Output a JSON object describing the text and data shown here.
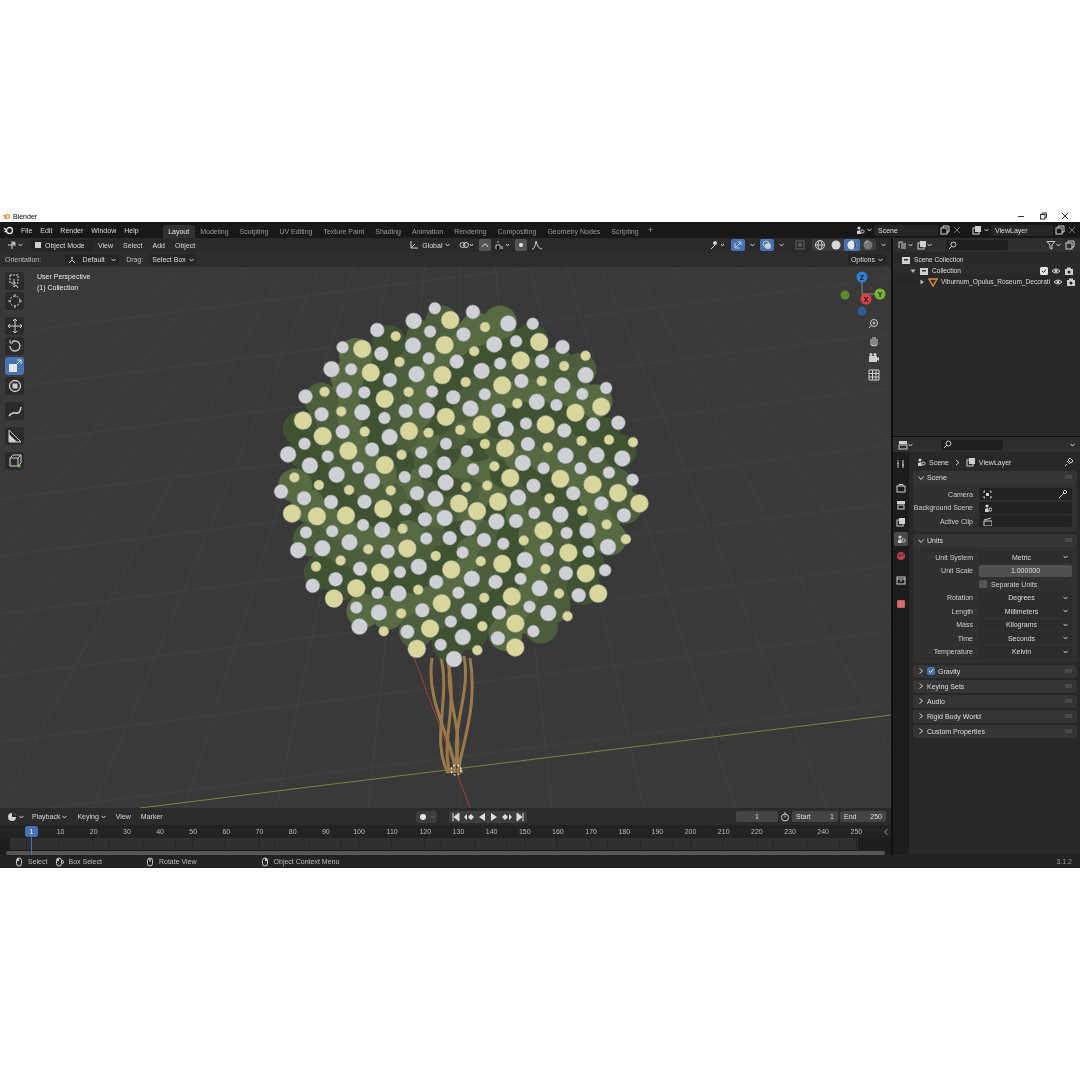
{
  "window": {
    "title": "Blender"
  },
  "menu": [
    "File",
    "Edit",
    "Render",
    "Window",
    "Help"
  ],
  "workspaces": [
    {
      "label": "Layout",
      "selected": true
    },
    {
      "label": "Modeling",
      "selected": false
    },
    {
      "label": "Sculpting",
      "selected": false
    },
    {
      "label": "UV Editing",
      "selected": false
    },
    {
      "label": "Texture Paint",
      "selected": false
    },
    {
      "label": "Shading",
      "selected": false
    },
    {
      "label": "Animation",
      "selected": false
    },
    {
      "label": "Rendering",
      "selected": false
    },
    {
      "label": "Compositing",
      "selected": false
    },
    {
      "label": "Geometry Nodes",
      "selected": false
    },
    {
      "label": "Scripting",
      "selected": false
    }
  ],
  "add_workspace": "+",
  "scene": "Scene",
  "view_layer": "ViewLayer",
  "viewport": {
    "mode": "Object Mode",
    "menus": [
      "View",
      "Select",
      "Add",
      "Object"
    ],
    "transform_orientation": "Global",
    "orientation_label": "Orientation:",
    "orientation": "Default",
    "drag_label": "Drag:",
    "drag": "Select Box",
    "options": "Options",
    "view_name": "User Perspective",
    "collection_label": "(1) Collection",
    "show_gizmos": true,
    "show_overlays": true,
    "xray": false,
    "shading": [
      {
        "kind": "wireframe",
        "selected": false
      },
      {
        "kind": "solid",
        "selected": false
      },
      {
        "kind": "material",
        "selected": true
      },
      {
        "kind": "rendered",
        "selected": false
      }
    ],
    "tools": [
      {
        "kind": "select_box",
        "selected": false
      },
      {
        "kind": "cursor",
        "selected": false
      },
      {
        "kind": "move",
        "selected": false
      },
      {
        "kind": "rotate",
        "selected": false
      },
      {
        "kind": "scale",
        "selected": true
      },
      {
        "kind": "transform",
        "selected": false
      },
      {
        "kind": "annotate",
        "selected": false
      },
      {
        "kind": "measure",
        "selected": false
      },
      {
        "kind": "add_cube",
        "selected": false
      }
    ],
    "gizmo_axes": [
      "Z",
      "Y",
      "X"
    ]
  },
  "outliner": {
    "tree": [
      {
        "label": "Scene Collection",
        "children": [
          {
            "label": "Collection",
            "expanded": true,
            "checked": true,
            "children": [
              {
                "label": "Viburnum_Opulus_Roseum_Decorati",
                "expanded": false
              }
            ]
          }
        ]
      }
    ]
  },
  "properties": {
    "tabs": [
      {
        "kind": "tool",
        "selected": false
      },
      {
        "kind": "render",
        "selected": false
      },
      {
        "kind": "output",
        "selected": false
      },
      {
        "kind": "view_layer",
        "selected": false
      },
      {
        "kind": "scene",
        "selected": true
      },
      {
        "kind": "world",
        "selected": false
      },
      {
        "kind": "collection",
        "selected": false
      },
      {
        "kind": "texture",
        "selected": false
      }
    ],
    "breadcrumb": [
      "Scene",
      "ViewLayer"
    ],
    "panels": [
      {
        "title": "Scene",
        "expanded": true,
        "rows": [
          {
            "label": "Camera",
            "kind": "camera"
          },
          {
            "label": "Background Scene",
            "kind": "scene"
          },
          {
            "label": "Active Clip",
            "kind": "clip"
          }
        ]
      },
      {
        "title": "Units",
        "expanded": true,
        "rows": [
          {
            "label": "Unit System",
            "kind": "dropdown",
            "value": "Metric"
          },
          {
            "label": "Unit Scale",
            "kind": "number",
            "value": "1.000000"
          },
          {
            "label": "Separate Units",
            "kind": "checkbox",
            "checked": false
          },
          {
            "label": "Rotation",
            "kind": "dropdown",
            "value": "Degrees"
          },
          {
            "label": "Length",
            "kind": "dropdown",
            "value": "Millimeters"
          },
          {
            "label": "Mass",
            "kind": "dropdown",
            "value": "Kilograms"
          },
          {
            "label": "Time",
            "kind": "dropdown",
            "value": "Seconds"
          },
          {
            "label": "Temperature",
            "kind": "dropdown",
            "value": "Kelvin"
          }
        ]
      },
      {
        "title": "Gravity",
        "expanded": false,
        "checked": true
      },
      {
        "title": "Keying Sets",
        "expanded": false
      },
      {
        "title": "Audio",
        "expanded": false
      },
      {
        "title": "Rigid Body World",
        "expanded": false
      },
      {
        "title": "Custom Properties",
        "expanded": false
      }
    ]
  },
  "timeline": {
    "menus": [
      {
        "label": "Playback",
        "kind": "dropdown"
      },
      {
        "label": "Keying",
        "kind": "dropdown"
      },
      {
        "label": "View",
        "kind": "menu"
      },
      {
        "label": "Marker",
        "kind": "menu"
      }
    ],
    "current_frame": "1",
    "start_label": "Start",
    "start": "1",
    "end_label": "End",
    "end": "250",
    "playhead": "1",
    "ruler": [
      "10",
      "20",
      "30",
      "40",
      "50",
      "60",
      "70",
      "80",
      "90",
      "100",
      "110",
      "120",
      "130",
      "140",
      "150",
      "160",
      "170",
      "180",
      "190",
      "200",
      "210",
      "220",
      "230",
      "240",
      "250"
    ]
  },
  "status_bar": {
    "hints": [
      {
        "kind": "left_click",
        "label": "Select"
      },
      {
        "kind": "drag",
        "label": "Box Select"
      },
      {
        "kind": "middle_click",
        "label": "Rotate View"
      },
      {
        "kind": "right_click",
        "label": "Object Context Menu"
      }
    ],
    "version": "3.1.2"
  }
}
